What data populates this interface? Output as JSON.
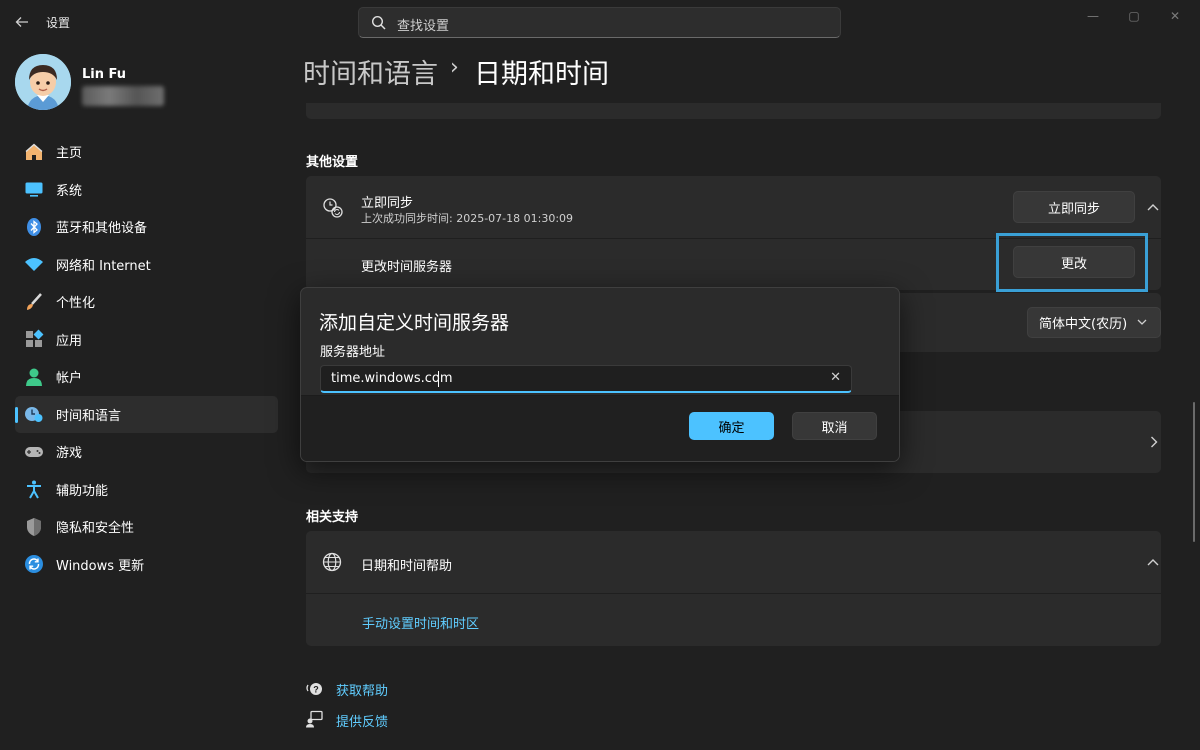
{
  "window": {
    "title": "设置",
    "controls": {
      "minimize": "—",
      "maximize": "▢",
      "close": "✕"
    }
  },
  "search": {
    "placeholder": "查找设置"
  },
  "user": {
    "name": "Lin Fu"
  },
  "nav": {
    "items": [
      {
        "label": "主页",
        "icon": "home-icon"
      },
      {
        "label": "系统",
        "icon": "system-icon"
      },
      {
        "label": "蓝牙和其他设备",
        "icon": "bluetooth-icon"
      },
      {
        "label": "网络和 Internet",
        "icon": "wifi-icon"
      },
      {
        "label": "个性化",
        "icon": "brush-icon"
      },
      {
        "label": "应用",
        "icon": "apps-icon"
      },
      {
        "label": "帐户",
        "icon": "account-icon"
      },
      {
        "label": "时间和语言",
        "icon": "time-language-icon",
        "active": true
      },
      {
        "label": "游戏",
        "icon": "gamepad-icon"
      },
      {
        "label": "辅助功能",
        "icon": "accessibility-icon"
      },
      {
        "label": "隐私和安全性",
        "icon": "shield-icon"
      },
      {
        "label": "Windows 更新",
        "icon": "update-icon"
      }
    ]
  },
  "breadcrumb": {
    "parent": "时间和语言",
    "separator": "›",
    "current": "日期和时间"
  },
  "other_settings": {
    "title": "其他设置",
    "sync": {
      "title": "立即同步",
      "subtitle": "上次成功同步时间: 2025-07-18 01:30:09",
      "button": "立即同步",
      "expand_icon": "chevron-up-icon"
    },
    "time_server": {
      "label": "更改时间服务器",
      "button": "更改"
    },
    "calendar": {
      "value": "简体中文(农历)"
    }
  },
  "related_support": {
    "title": "相关支持",
    "help": {
      "title": "日期和时间帮助",
      "link": "手动设置时间和时区"
    }
  },
  "footer": {
    "get_help": "获取帮助",
    "feedback": "提供反馈"
  },
  "dialog": {
    "title": "添加自定义时间服务器",
    "field_label": "服务器地址",
    "field_value": "time.windows.com",
    "clear": "✕",
    "ok": "确定",
    "cancel": "取消"
  },
  "colors": {
    "accent": "#4cc2ff",
    "link": "#60cdff",
    "background": "#202020",
    "card": "#2b2b2b"
  }
}
